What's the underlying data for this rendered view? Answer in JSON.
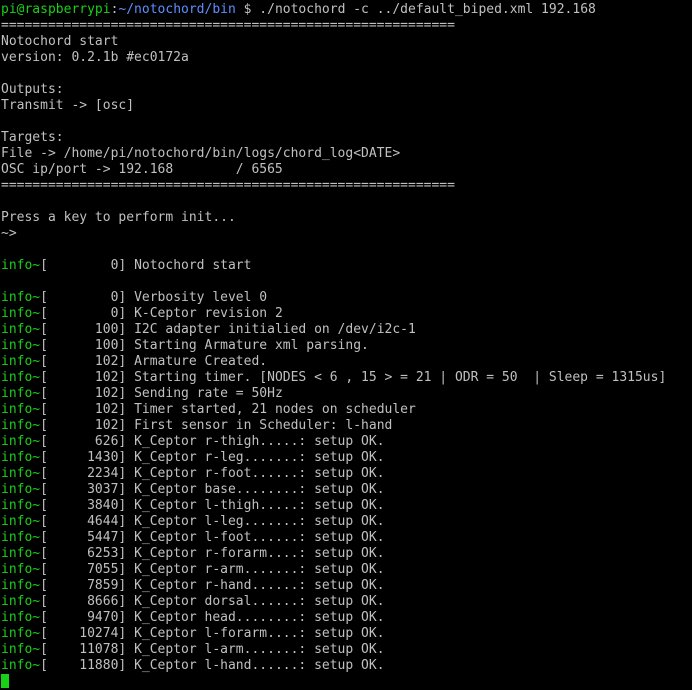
{
  "colors": {
    "background": "#000000",
    "text": "#c0c0c0",
    "prompt_user": "#18d018",
    "prompt_path": "#5c8fff",
    "log_tag": "#18d018",
    "cursor": "#18d018"
  },
  "prompt": {
    "user_host": "pi@raspberrypi",
    "separator": ":",
    "path": "~/notochord/bin",
    "symbol": " $ ",
    "command": "./notochord -c ../default_biped.xml 192.168"
  },
  "header_lines": [
    "==========================================================",
    "Notochord start",
    "version: 0.2.1b #ec0172a",
    "",
    "Outputs:",
    "Transmit -> [osc]",
    "",
    "Targets:",
    "File -> /home/pi/notochord/bin/logs/chord_log<DATE>",
    "OSC ip/port -> 192.168        / 6565",
    "==========================================================",
    "",
    "Press a key to perform init...",
    "~>",
    ""
  ],
  "log_groups": [
    [
      {
        "tag": "info~",
        "time": "0",
        "msg": "Notochord start"
      }
    ],
    [
      {
        "tag": "info~",
        "time": "0",
        "msg": "Verbosity level 0"
      },
      {
        "tag": "info~",
        "time": "0",
        "msg": "K-Ceptor revision 2"
      },
      {
        "tag": "info~",
        "time": "100",
        "msg": "I2C adapter initialied on /dev/i2c-1"
      },
      {
        "tag": "info~",
        "time": "100",
        "msg": "Starting Armature xml parsing."
      },
      {
        "tag": "info~",
        "time": "102",
        "msg": "Armature Created."
      },
      {
        "tag": "info~",
        "time": "102",
        "msg": "Starting timer. [NODES < 6 , 15 > = 21 | ODR = 50  | Sleep = 1315us]"
      },
      {
        "tag": "info~",
        "time": "102",
        "msg": "Sending rate = 50Hz"
      },
      {
        "tag": "info~",
        "time": "102",
        "msg": "Timer started, 21 nodes on scheduler"
      },
      {
        "tag": "info~",
        "time": "102",
        "msg": "First sensor in Scheduler: l-hand"
      },
      {
        "tag": "info~",
        "time": "626",
        "msg": "K_Ceptor r-thigh.....: setup OK."
      },
      {
        "tag": "info~",
        "time": "1430",
        "msg": "K_Ceptor r-leg.......: setup OK."
      },
      {
        "tag": "info~",
        "time": "2234",
        "msg": "K_Ceptor r-foot......: setup OK."
      },
      {
        "tag": "info~",
        "time": "3037",
        "msg": "K_Ceptor base........: setup OK."
      },
      {
        "tag": "info~",
        "time": "3840",
        "msg": "K_Ceptor l-thigh.....: setup OK."
      },
      {
        "tag": "info~",
        "time": "4644",
        "msg": "K_Ceptor l-leg.......: setup OK."
      },
      {
        "tag": "info~",
        "time": "5447",
        "msg": "K_Ceptor l-foot......: setup OK."
      },
      {
        "tag": "info~",
        "time": "6253",
        "msg": "K_Ceptor r-forarm....: setup OK."
      },
      {
        "tag": "info~",
        "time": "7055",
        "msg": "K_Ceptor r-arm.......: setup OK."
      },
      {
        "tag": "info~",
        "time": "7859",
        "msg": "K_Ceptor r-hand......: setup OK."
      },
      {
        "tag": "info~",
        "time": "8666",
        "msg": "K_Ceptor dorsal......: setup OK."
      },
      {
        "tag": "info~",
        "time": "9470",
        "msg": "K_Ceptor head........: setup OK."
      },
      {
        "tag": "info~",
        "time": "10274",
        "msg": "K_Ceptor l-forarm....: setup OK."
      },
      {
        "tag": "info~",
        "time": "11078",
        "msg": "K_Ceptor l-arm.......: setup OK."
      },
      {
        "tag": "info~",
        "time": "11880",
        "msg": "K_Ceptor l-hand......: setup OK."
      }
    ]
  ]
}
